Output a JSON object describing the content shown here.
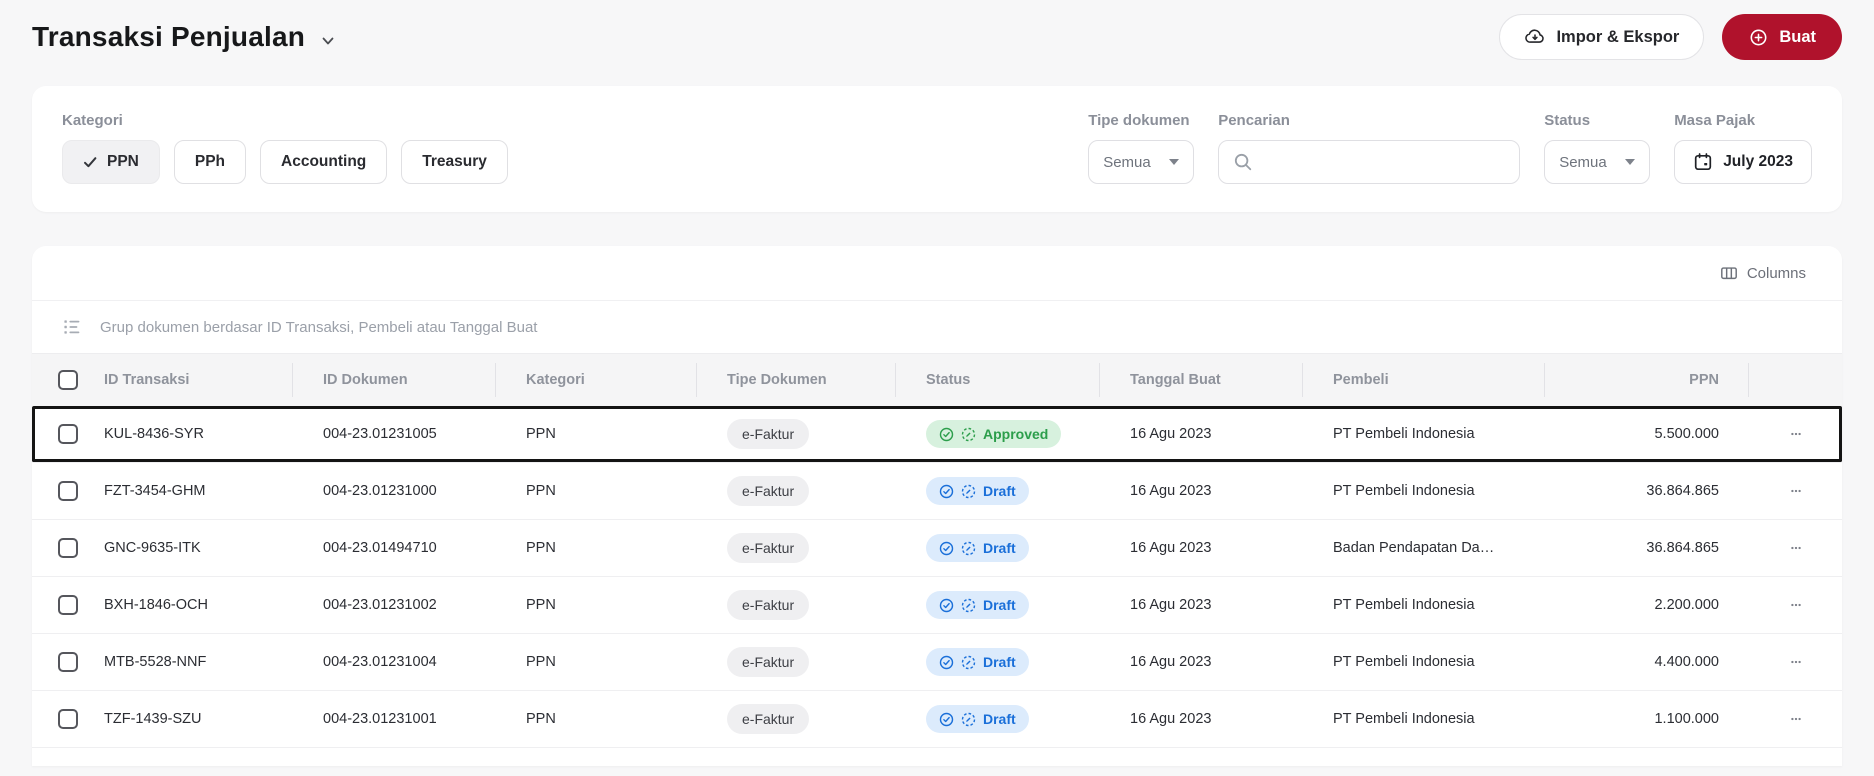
{
  "page": {
    "title": "Transaksi Penjualan"
  },
  "header": {
    "import_export_button": "Impor & Ekspor",
    "create_button": "Buat"
  },
  "filters": {
    "kategori": {
      "label": "Kategori",
      "options": [
        {
          "label": "PPN",
          "selected": true
        },
        {
          "label": "PPh",
          "selected": false
        },
        {
          "label": "Accounting",
          "selected": false
        },
        {
          "label": "Treasury",
          "selected": false
        }
      ]
    },
    "tipe_dokumen": {
      "label": "Tipe dokumen",
      "value": "Semua"
    },
    "pencarian": {
      "label": "Pencarian",
      "value": ""
    },
    "status": {
      "label": "Status",
      "value": "Semua"
    },
    "masa_pajak": {
      "label": "Masa Pajak",
      "value": "July 2023"
    }
  },
  "table": {
    "columns_button": "Columns",
    "group_bar_text": "Grup dokumen berdasar ID Transaksi, Pembeli atau Tanggal Buat",
    "headers": [
      "ID Transaksi",
      "ID Dokumen",
      "Kategori",
      "Tipe Dokumen",
      "Status",
      "Tanggal Buat",
      "Pembeli",
      "PPN"
    ],
    "rows": [
      {
        "id_transaksi": "KUL-8436-SYR",
        "id_dokumen": "004-23.01231005",
        "kategori": "PPN",
        "tipe_dokumen": "e-Faktur",
        "status": "Approved",
        "status_type": "approved",
        "tanggal_buat": "16 Agu 2023",
        "pembeli": "PT Pembeli Indonesia",
        "ppn": "5.500.000",
        "highlighted": true
      },
      {
        "id_transaksi": "FZT-3454-GHM",
        "id_dokumen": "004-23.01231000",
        "kategori": "PPN",
        "tipe_dokumen": "e-Faktur",
        "status": "Draft",
        "status_type": "draft",
        "tanggal_buat": "16 Agu 2023",
        "pembeli": "PT Pembeli Indonesia",
        "ppn": "36.864.865",
        "highlighted": false
      },
      {
        "id_transaksi": "GNC-9635-ITK",
        "id_dokumen": "004-23.01494710",
        "kategori": "PPN",
        "tipe_dokumen": "e-Faktur",
        "status": "Draft",
        "status_type": "draft",
        "tanggal_buat": "16 Agu 2023",
        "pembeli": "Badan Pendapatan Da…",
        "ppn": "36.864.865",
        "highlighted": false
      },
      {
        "id_transaksi": "BXH-1846-OCH",
        "id_dokumen": "004-23.01231002",
        "kategori": "PPN",
        "tipe_dokumen": "e-Faktur",
        "status": "Draft",
        "status_type": "draft",
        "tanggal_buat": "16 Agu 2023",
        "pembeli": "PT Pembeli Indonesia",
        "ppn": "2.200.000",
        "highlighted": false
      },
      {
        "id_transaksi": "MTB-5528-NNF",
        "id_dokumen": "004-23.01231004",
        "kategori": "PPN",
        "tipe_dokumen": "e-Faktur",
        "status": "Draft",
        "status_type": "draft",
        "tanggal_buat": "16 Agu 2023",
        "pembeli": "PT Pembeli Indonesia",
        "ppn": "4.400.000",
        "highlighted": false
      },
      {
        "id_transaksi": "TZF-1439-SZU",
        "id_dokumen": "004-23.01231001",
        "kategori": "PPN",
        "tipe_dokumen": "e-Faktur",
        "status": "Draft",
        "status_type": "draft",
        "tanggal_buat": "16 Agu 2023",
        "pembeli": "PT Pembeli Indonesia",
        "ppn": "1.100.000",
        "highlighted": false
      }
    ]
  },
  "icons": {
    "title_caret": "chevron-down",
    "import_export": "cloud-download",
    "create": "plus-circle",
    "selected_chip": "check",
    "select_caret": "caret-down",
    "search": "magnifier",
    "masa_pajak": "calendar",
    "columns": "columns-layout",
    "group_bar": "grouped-list",
    "status_approved": "check-circle",
    "status_draft": "dashed-circle-pencil",
    "row_actions": "ellipsis"
  },
  "colors": {
    "accent_red": "#b0122c",
    "approved_text": "#2c9e4b",
    "approved_bg": "#d7f1de",
    "draft_text": "#1a6fd9",
    "draft_bg": "#dcebfc",
    "doc_pill_bg": "#efeff1",
    "highlight_border": "#141414",
    "page_bg": "#f7f7f8"
  }
}
